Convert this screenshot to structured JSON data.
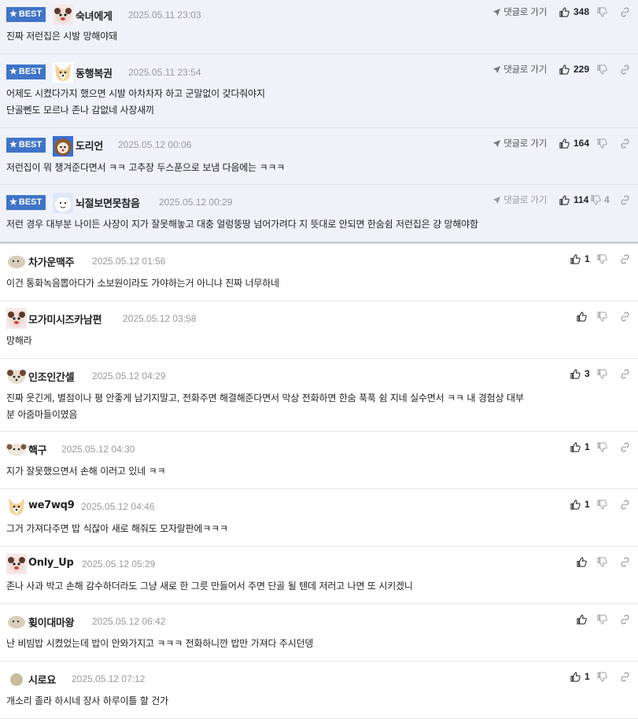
{
  "best_comments": [
    {
      "badge": "BEST",
      "nick": "숙녀에게",
      "date": "2025.05.11 23:03",
      "reply": "댓글로 가기",
      "up": "348",
      "down": "",
      "lines": [
        "진짜 저런집은 시발 망해야돼"
      ]
    },
    {
      "badge": "BEST",
      "nick": "동행복권",
      "date": "2025.05.11 23:54",
      "reply": "댓글로 가기",
      "up": "229",
      "down": "",
      "lines": [
        "어제도 시켰다가지 했으면 시발 아차차자 하고 군말없이 갖다줘야지",
        "단골뻰도 모르나 존나 감없네 사장새끼"
      ]
    },
    {
      "badge": "BEST",
      "nick": "도리언",
      "date": "2025.05.12 00:06",
      "reply": "댓글로 가기",
      "up": "164",
      "down": "",
      "lines": [
        "저런집이 뭐 챙겨준다면서 ㅋㅋ 고추장 두스푼으로 보냄 다음에는 ㅋㅋㅋ"
      ]
    },
    {
      "badge": "BEST",
      "nick": "뇌절보면못참음",
      "date": "2025.05.12 00:29",
      "reply": "댓글로 가기",
      "up": "114",
      "down": "4",
      "lines": [
        "저런 경우 대부분 나이든 사장이 지가 잘못해놓고 대충 얼렁뚱땅 넘어가려다 지 뜻대로 안되면 한숨쉼 저런집은 걍 망해야함"
      ]
    }
  ],
  "comments": [
    {
      "nick": "차가운맥주",
      "date": "2025.05.12 01:56",
      "up": "1",
      "lines": [
        "이건 통화녹음뽑아다가 소보원이라도 가야하는거 아니냐 진짜 너무하네"
      ]
    },
    {
      "nick": "모가미시즈카남편",
      "date": "2025.05.12 03:58",
      "up": "",
      "lines": [
        "망해라"
      ]
    },
    {
      "nick": "인조인간셀",
      "date": "2025.05.12 04:29",
      "up": "3",
      "lines": [
        "진짜 웃긴게, 별점이나 평 안좋게 남기지말고, 전화주면 해결해준다면서 막상 전화하면 한숨 푹푹 쉼 지네 실수면서 ㅋㅋ 내 경험상 대부",
        "분 아줌마들이였음"
      ]
    },
    {
      "nick": "핵구",
      "date": "2025.05.12 04:30",
      "up": "1",
      "lines": [
        "지가 잘못했으면서 손해 이러고 있네 ㅋㅋ"
      ]
    },
    {
      "nick": "we7wq9",
      "date": "2025.05.12 04:46",
      "up": "1",
      "lines": [
        "그거 가져다주면 밥 식잖아 새로 해줘도 모자랄판에ㅋㅋㅋ"
      ]
    },
    {
      "nick": "Only_Up",
      "date": "2025.05.12 05:29",
      "up": "",
      "lines": [
        "존나 사과 박고 손해 감수하더라도 그냥 새로 한 그릇 만들어서 주면 단골 될 텐데 저러고 나면 또 시키겠니"
      ]
    },
    {
      "nick": "휮이대마왕",
      "date": "2025.05.12 06:42",
      "up": "",
      "lines": [
        "난 비빔밥 시켰었는데 밥이 안와가지고 ㅋㅋㅋ 전화하니깐 밥만 가져다 주시던뎅"
      ]
    },
    {
      "nick": "시로요",
      "date": "2025.05.12 07:12",
      "up": "1",
      "lines": [
        "개소리 졸라 하시네 장사 하루이틀 할 건가"
      ]
    }
  ],
  "icons": {
    "best_star": "star-icon",
    "reply": "arrow-send-icon",
    "up": "thumbs-up-icon",
    "down": "thumbs-down-icon",
    "link": "link-icon"
  },
  "colors": {
    "best_badge": "#3f74c8",
    "best_background": "#eff2f9",
    "date": "#9a9a9a"
  }
}
